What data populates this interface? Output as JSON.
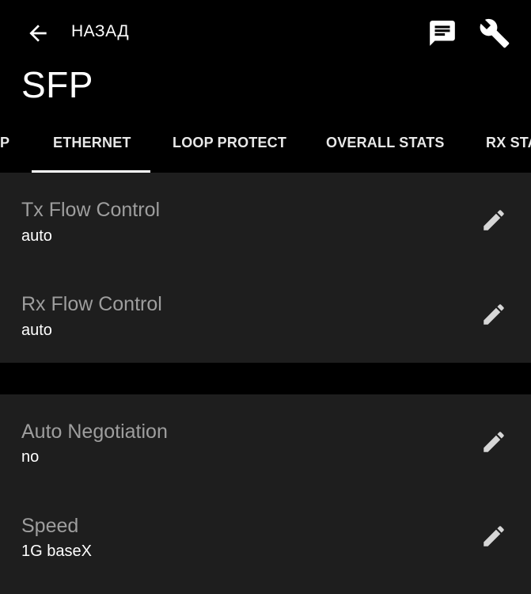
{
  "appbar": {
    "back_label": "НАЗАД",
    "back_icon": "arrow-left-icon",
    "actions": [
      {
        "name": "chat",
        "icon": "chat-icon"
      },
      {
        "name": "tools",
        "icon": "wrench-icon"
      }
    ]
  },
  "page": {
    "title": "SFP"
  },
  "tabs": {
    "items": [
      {
        "label": "P"
      },
      {
        "label": "ETHERNET",
        "selected": true
      },
      {
        "label": "LOOP PROTECT"
      },
      {
        "label": "OVERALL STATS"
      },
      {
        "label": "RX STATS"
      }
    ]
  },
  "sections": [
    {
      "rows": [
        {
          "label": "Tx Flow Control",
          "value": "auto",
          "action_icon": "pencil-icon"
        },
        {
          "label": "Rx Flow Control",
          "value": "auto",
          "action_icon": "pencil-icon"
        }
      ]
    },
    {
      "rows": [
        {
          "label": "Auto Negotiation",
          "value": "no",
          "action_icon": "pencil-icon"
        },
        {
          "label": "Speed",
          "value": "1G baseX",
          "action_icon": "pencil-icon"
        }
      ]
    }
  ],
  "colors": {
    "background": "#000000",
    "surface": "#1e1e1e",
    "label": "#9e9e9e",
    "value": "#ffffff",
    "icon": "#d6d6d6"
  }
}
